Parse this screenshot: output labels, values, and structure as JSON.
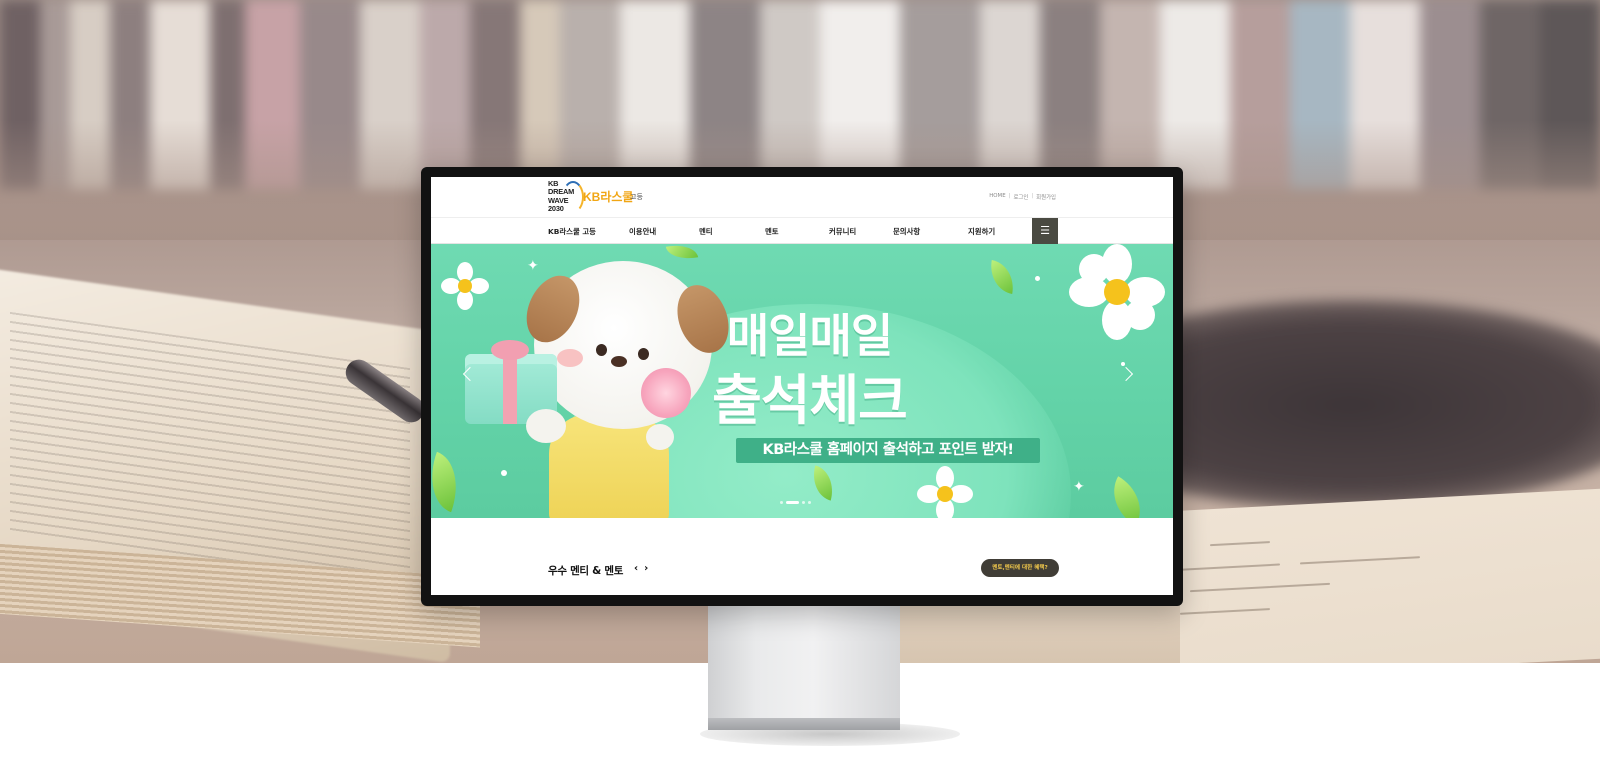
{
  "site": {
    "logo_mark_lines": [
      "KB",
      "DREAM",
      "WAVE",
      "2030"
    ],
    "logo_name": "KB라스쿨",
    "logo_sub": "고등",
    "util_links": [
      "HOME",
      "로그인",
      "회원가입"
    ],
    "util_separator": "|"
  },
  "gnb": {
    "items": [
      "KB라스쿨 고등",
      "이용안내",
      "멘티",
      "멘토",
      "커뮤니티",
      "문의사항",
      "지원하기"
    ],
    "menu_icon": "hamburger-icon",
    "menu_glyph": "☰"
  },
  "banner": {
    "title_line1": "매일매일",
    "title_line2": "출석체크",
    "pill_text": "KB라스쿨 홈페이지 출석하고 포인트 받자!",
    "prev_icon": "chevron-left-icon",
    "next_icon": "chevron-right-icon",
    "slide_count": 4,
    "active_slide": 2,
    "colors": {
      "background": "#63d3a8",
      "pill": "#3fb088"
    }
  },
  "section": {
    "title": "우수 멘티 & 멘토",
    "nav_prev": "‹",
    "nav_next": "›",
    "benefit_button": "멘토,멘티에 대한 혜택?"
  },
  "colors": {
    "accent": "#f1a614",
    "menu_button": "#4a4a42",
    "benefit_button_bg": "#403d36",
    "benefit_button_text": "#f2c94c"
  }
}
